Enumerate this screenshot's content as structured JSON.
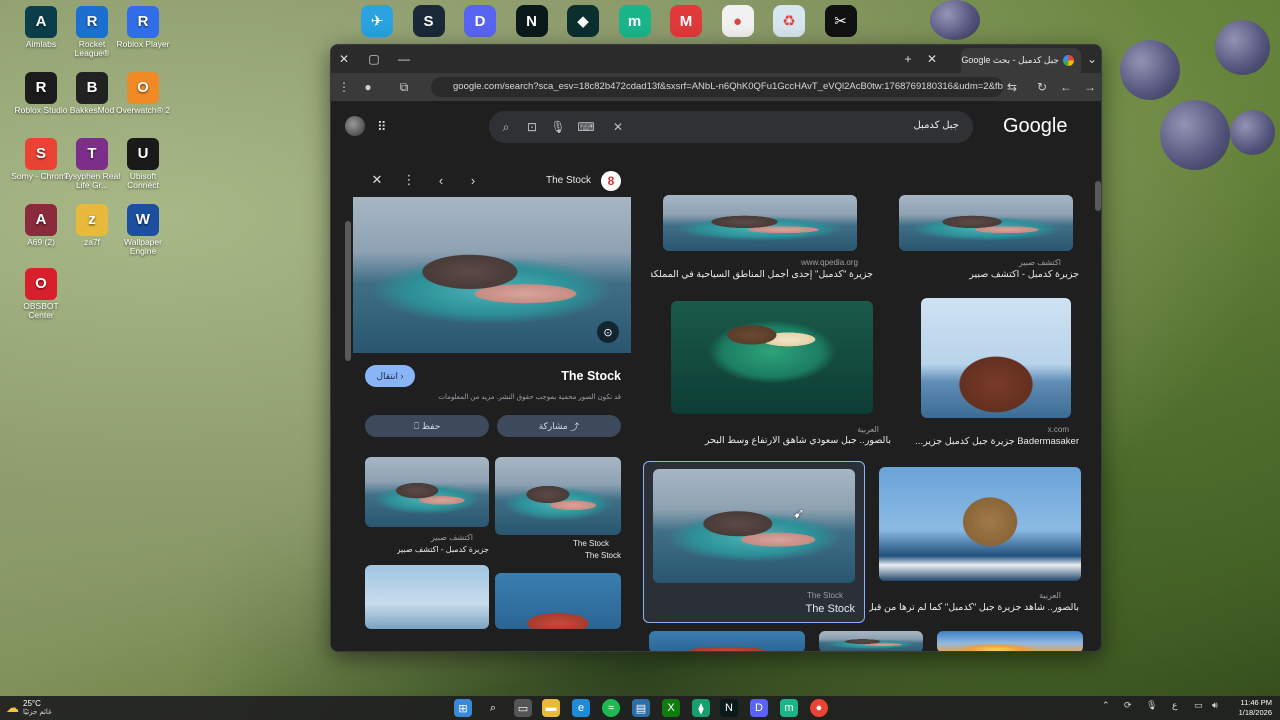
{
  "desktop": {
    "left_icons": [
      {
        "label": "Aimlabs",
        "icon": "aimlabs-icon",
        "color": "#0b3d4a"
      },
      {
        "label": "Rocket League®",
        "icon": "rocket-league-icon",
        "color": "#1a6fd0"
      },
      {
        "label": "Roblox Player",
        "icon": "roblox-icon",
        "color": "#2f6ee8"
      },
      {
        "label": "Roblox Studio",
        "icon": "roblox-studio-icon",
        "color": "#1b1b1b"
      },
      {
        "label": "BakkesMod",
        "icon": "bakkesmod-icon",
        "color": "#222222"
      },
      {
        "label": "Overwatch® 2",
        "icon": "overwatch-icon",
        "color": "#f08a24"
      },
      {
        "label": "Somy - Chrome",
        "icon": "chrome-icon",
        "color": "#ea4335"
      },
      {
        "label": "Tysyphen Real Life Gr...",
        "icon": "winrar-icon",
        "color": "#7b2f8a"
      },
      {
        "label": "Ubisoft Connect",
        "icon": "ubisoft-icon",
        "color": "#1a1a1a"
      },
      {
        "label": "A69 (2)",
        "icon": "winrar-icon",
        "color": "#8a2a3a"
      },
      {
        "label": "za7f",
        "icon": "folder-icon",
        "color": "#e8b93a"
      },
      {
        "label": "Wallpaper Engine",
        "icon": "wallpaper-engine-icon",
        "color": "#1d4fa0"
      },
      {
        "label": "OBSBOT Center",
        "icon": "obsbot-icon",
        "color": "#d8202c"
      }
    ],
    "top_icons": [
      {
        "icon": "telegram-icon",
        "color": "#2aa3e0",
        "glyph": "✈"
      },
      {
        "icon": "steam-icon",
        "color": "#1b2838",
        "glyph": "S"
      },
      {
        "icon": "discord-icon",
        "color": "#5865f2",
        "glyph": "D"
      },
      {
        "icon": "app-icon",
        "color": "#0a1a1a",
        "glyph": "N"
      },
      {
        "icon": "gem-icon",
        "color": "#0b2e2e",
        "glyph": "◆"
      },
      {
        "icon": "app-icon",
        "color": "#1bb58a",
        "glyph": "m"
      },
      {
        "icon": "app-icon",
        "color": "#e03a3a",
        "glyph": "M"
      },
      {
        "icon": "chrome-icon",
        "color": "#f1f1f1",
        "glyph": "●"
      },
      {
        "icon": "recycle-bin-icon",
        "color": "#d8e6f0",
        "glyph": "♻"
      },
      {
        "icon": "capcut-icon",
        "color": "#111111",
        "glyph": "✂"
      }
    ]
  },
  "browser": {
    "tab_title": "جبل كدمبل - بحث Google",
    "url": "google.com/search?sca_esv=18c82b472cdad13f&sxsrf=ANbL-n6QhK0QFu1GccHAvT_eVQl2AcB0tw:1768769180316&udm=2&fbs...",
    "search_query": "جبل كدمبل",
    "logo": "Google"
  },
  "panel": {
    "source_name": "The Stock",
    "title": "The Stock",
    "visit_label": "انتقال",
    "notice": "قد تكون الصور محمية بموجب حقوق النشر. مزيد من المعلومات",
    "share_label": "مشاركة",
    "save_label": "حفظ",
    "related": [
      {
        "caption": "جزيرة كدمبل - اكتشف صبير",
        "source": "اكتشف صبير"
      },
      {
        "caption": "The Stock",
        "source": "The Stock"
      }
    ]
  },
  "results": [
    {
      "source": "www.qpedia.org",
      "caption": "جزيرة \"كدمبل\" إحدى أجمل المناطق السياحية في المملكة - e..."
    },
    {
      "source": "اكتشف صبير",
      "caption": "جزيرة كدمبل - اكتشف صبير"
    },
    {
      "source": "العربية",
      "caption": "بالصور.. جبل سعودي شاهق الارتفاع وسط البحر"
    },
    {
      "source": "x.com",
      "caption": "Badermasaker جزيرة جبل كدمبل جزير..."
    },
    {
      "source": "The Stock",
      "caption": "The Stock"
    },
    {
      "source": "العربية",
      "caption": "بالصور.. شاهد جزيرة جبل \"كدمبل\" كما لم ترها من قبل"
    }
  ],
  "taskbar": {
    "weather_temp": "25°C",
    "weather_text": "غائم جزئيًا",
    "time": "11:46 PM",
    "date": "1/18/2026",
    "lang": "ع"
  }
}
